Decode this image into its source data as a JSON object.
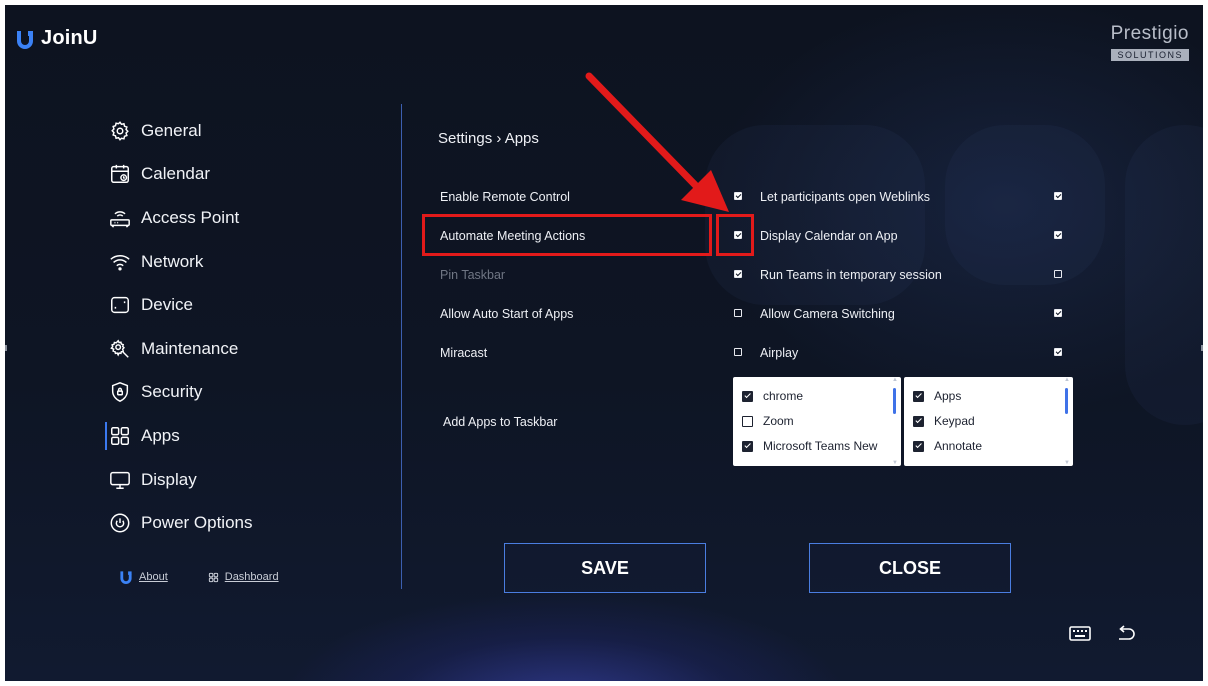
{
  "header": {
    "app_name": "JoinU",
    "brand_name": "Prestigio",
    "brand_sub": "SOLUTIONS"
  },
  "sidebar": {
    "items": [
      {
        "label": "General",
        "icon": "gear-icon"
      },
      {
        "label": "Calendar",
        "icon": "calendar-icon"
      },
      {
        "label": "Access Point",
        "icon": "router-icon"
      },
      {
        "label": "Network",
        "icon": "wifi-icon"
      },
      {
        "label": "Device",
        "icon": "device-icon"
      },
      {
        "label": "Maintenance",
        "icon": "maintenance-icon"
      },
      {
        "label": "Security",
        "icon": "shield-icon"
      },
      {
        "label": "Apps",
        "icon": "apps-grid-icon",
        "active": true
      },
      {
        "label": "Display",
        "icon": "monitor-icon"
      },
      {
        "label": "Power Options",
        "icon": "power-icon"
      }
    ],
    "bottom": {
      "about_label": "About",
      "dashboard_label": "Dashboard"
    }
  },
  "main": {
    "breadcrumb": "Settings › Apps",
    "left_options": [
      {
        "label": "Enable Remote Control",
        "checked": true,
        "dim": false
      },
      {
        "label": "Automate Meeting Actions",
        "checked": true,
        "dim": false
      },
      {
        "label": "Pin Taskbar",
        "checked": true,
        "dim": true
      },
      {
        "label": "Allow Auto Start of Apps",
        "checked": false,
        "dim": false
      },
      {
        "label": "Miracast",
        "checked": false,
        "dim": false
      }
    ],
    "right_options": [
      {
        "label": "Let participants open Weblinks",
        "checked": true
      },
      {
        "label": "Display Calendar on App",
        "checked": true
      },
      {
        "label": "Run Teams in temporary session",
        "checked": false
      },
      {
        "label": "Allow Camera Switching",
        "checked": true
      },
      {
        "label": "Airplay",
        "checked": true
      }
    ],
    "taskbar_label": "Add Apps to Taskbar",
    "apps_list_1": [
      {
        "label": "chrome",
        "checked": true
      },
      {
        "label": "Zoom",
        "checked": false
      },
      {
        "label": "Microsoft Teams New",
        "checked": true
      }
    ],
    "apps_list_2": [
      {
        "label": "Apps",
        "checked": true
      },
      {
        "label": "Keypad",
        "checked": true
      },
      {
        "label": "Annotate",
        "checked": true
      }
    ]
  },
  "buttons": {
    "save_label": "SAVE",
    "close_label": "CLOSE"
  },
  "colors": {
    "background": "#0e1524",
    "accent": "#3b79f0",
    "annotation_red": "#e21a1a"
  }
}
